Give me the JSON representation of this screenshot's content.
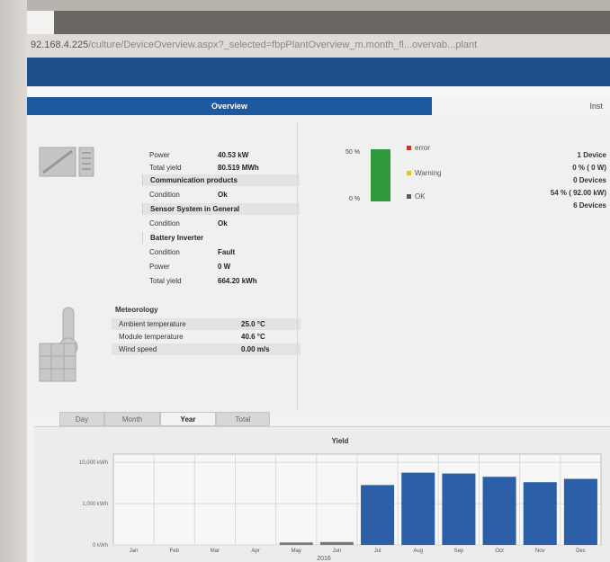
{
  "browser": {
    "url_ip": "92.168.4.225",
    "url_rest": "/culture/DeviceOverview.aspx?_selected=fbpPlantOverview_m.month_fl...overvab...plant"
  },
  "tabs": {
    "overview": "Overview",
    "right": "Inst"
  },
  "inverters": {
    "power_label": "Power",
    "power_value": "40.53 kW",
    "total_yield_label": "Total yield",
    "total_yield_value": "80.519 MWh"
  },
  "communication": {
    "title": "Communication products",
    "condition_label": "Condition",
    "condition_value": "Ok"
  },
  "sensor": {
    "title": "Sensor System in General",
    "condition_label": "Condition",
    "condition_value": "Ok"
  },
  "battery": {
    "title": "Battery Inverter",
    "condition_label": "Condition",
    "condition_value": "Fault",
    "power_label": "Power",
    "power_value": "0 W",
    "total_yield_label": "Total yield",
    "total_yield_value": "664.20 kWh"
  },
  "meteorology": {
    "title": "Meteorology",
    "ambient_label": "Ambient temperature",
    "ambient_value": "25.0 °C",
    "module_label": "Module temperature",
    "module_value": "40.6 °C",
    "wind_label": "Wind speed",
    "wind_value": "0.00 m/s"
  },
  "status": {
    "pct_top": "50 %",
    "pct_bottom": "0 %",
    "legend_error": "error",
    "legend_warning": "Warning",
    "legend_ok": "OK",
    "right_1": "1 Device",
    "right_2": "0 % ( 0 W)",
    "right_3": "0 Devices",
    "right_4": "54 % ( 92.00 kW)",
    "right_5": "6 Devices",
    "colors": {
      "error": "#c0392b",
      "warning": "#d8c436",
      "ok": "#5a5a5a",
      "bar": "#2e9a3b"
    }
  },
  "period_tabs": {
    "day": "Day",
    "month": "Month",
    "year": "Year",
    "total": "Total"
  },
  "chart_data": {
    "type": "bar",
    "title": "Yield",
    "categories": [
      "Jan",
      "Feb",
      "Mar",
      "Apr",
      "May",
      "Jun",
      "Jul",
      "Aug",
      "Sep",
      "Oct",
      "Nov",
      "Dec"
    ],
    "series": [
      {
        "values": [
          0,
          0,
          0,
          0,
          600,
          700,
          14500,
          17500,
          17300,
          16500,
          15200,
          16000
        ],
        "color": "#2b5fa8"
      }
    ],
    "gray_indices": [
      4,
      5
    ],
    "ytick_labels": [
      "10,000 kWh",
      "1,000 kWh",
      "0 kWh"
    ],
    "ytick_values": [
      20000,
      10000,
      0
    ],
    "ylim": [
      0,
      22000
    ],
    "year_label": "2016",
    "grid": true,
    "gray_color": "#7a7a7a"
  }
}
